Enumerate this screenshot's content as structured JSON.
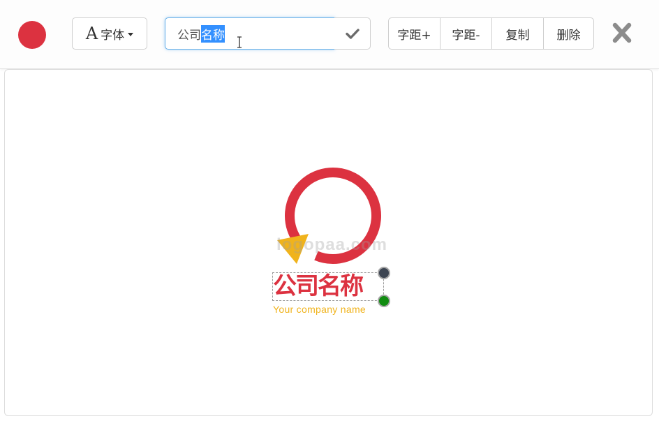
{
  "colors": {
    "brand_red": "#dc3240",
    "accent_yellow": "#f0b31c",
    "handle_dark": "#3d4552",
    "handle_green": "#118c11"
  },
  "toolbar": {
    "color_picker_icon": "red-circle",
    "font_button": {
      "glyph": "A",
      "label": "字体"
    },
    "text_input": {
      "value_plain": "公司",
      "value_selected": "名称"
    },
    "confirm_icon": "check-icon",
    "buttons": {
      "spacing_increase": "字距+",
      "spacing_decrease": "字距-",
      "copy": "复制",
      "delete": "删除"
    },
    "close_icon": "close-icon"
  },
  "canvas": {
    "watermark": "logopaa.com",
    "company_name": "公司名称",
    "slogan": "Your company name"
  }
}
